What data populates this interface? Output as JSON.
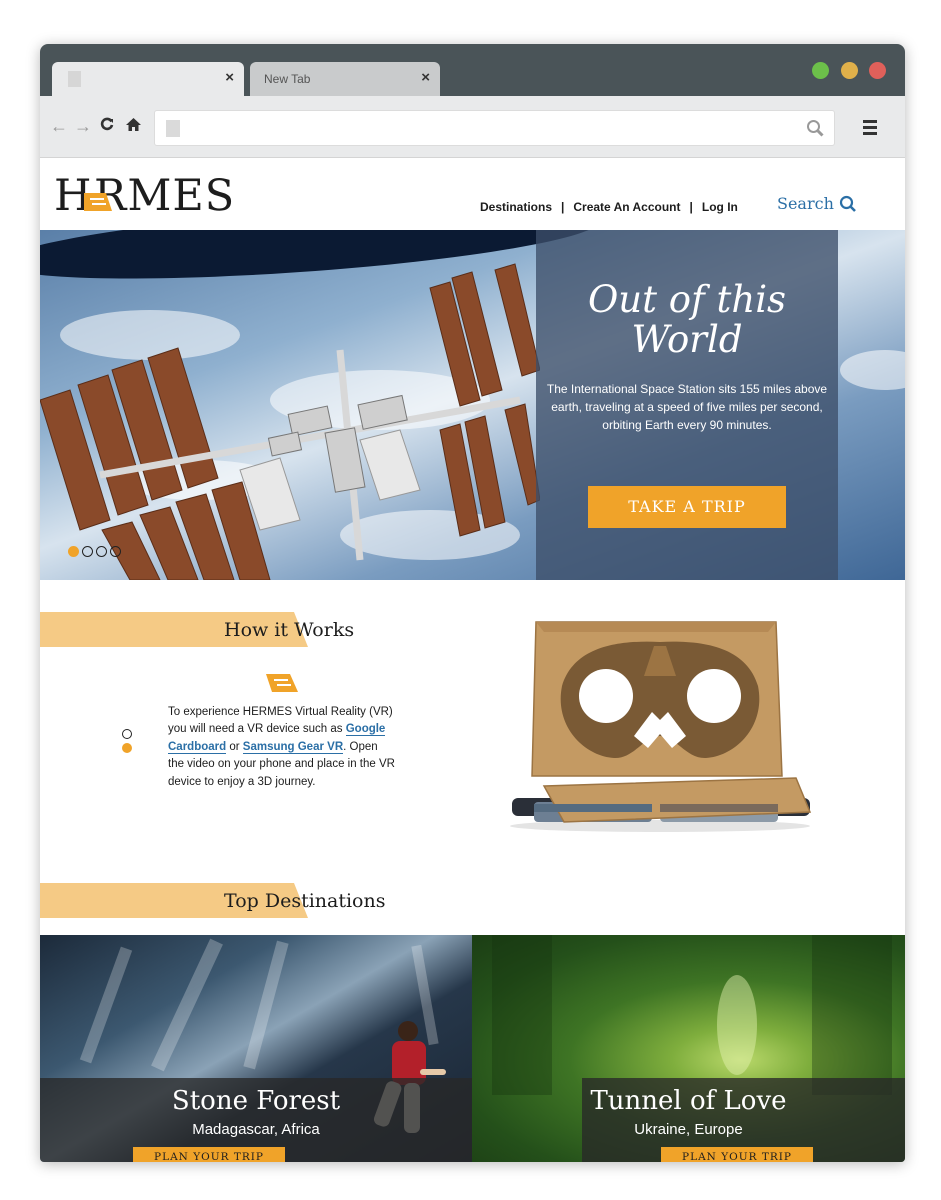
{
  "browser": {
    "tabs": [
      {
        "title": "",
        "close": "×",
        "active": true
      },
      {
        "title": "New Tab",
        "close": "×",
        "active": false
      }
    ],
    "window_controls": [
      "green",
      "yellow",
      "red"
    ],
    "nav_icons": {
      "back": "←",
      "forward": "→",
      "reload": "C",
      "home": "home-icon"
    },
    "address": "",
    "menu_icon": "hamburger-icon"
  },
  "site": {
    "logo": "HERMES",
    "logo_rest": "RMES",
    "nav": [
      {
        "label": "Destinations"
      },
      {
        "label": "Create An Account"
      },
      {
        "label": "Log In"
      }
    ],
    "nav_separator": "|",
    "search_label": "Search"
  },
  "hero": {
    "title_line1": "Out of this",
    "title_line2": "World",
    "description": "The International Space Station sits 155 miles above earth, traveling at a speed of five miles per second, orbiting Earth every 90 minutes.",
    "cta_label": "TAKE A TRIP",
    "carousel_dots": 4,
    "active_dot": 0
  },
  "how_it_works": {
    "title": "How it Works",
    "text_before": "To experience HERMES Virtual Reality (VR) you will need a VR device such as ",
    "link1": "Google Cardboard",
    "text_mid": " or ",
    "link2": "Samsung Gear VR",
    "text_after": ". Open the video on your phone and place in the VR device to enjoy a 3D journey."
  },
  "top_destinations": {
    "title": "Top Destinations",
    "items": [
      {
        "name": "Stone Forest",
        "location": "Madagascar, Africa",
        "button": "PLAN YOUR TRIP"
      },
      {
        "name": "Tunnel of Love",
        "location": "Ukraine, Europe",
        "button": "PLAN YOUR TRIP"
      }
    ]
  },
  "colors": {
    "accent": "#f0a329",
    "banner": "#f5ca85",
    "link": "#2b6fa6",
    "chrome_dark": "#4a5458"
  }
}
